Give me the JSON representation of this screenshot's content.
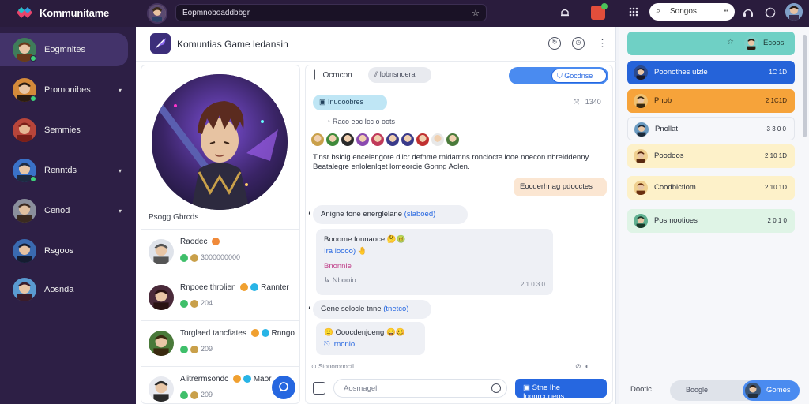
{
  "topbar": {
    "brand": "Kommunitame",
    "search_value": "Eopmnoboaddbbgr",
    "right_search": "Songos"
  },
  "sidebar": {
    "items": [
      {
        "label": "Eogmnites",
        "active": true,
        "chevron": false,
        "online": true
      },
      {
        "label": "Promonibes",
        "chevron": true,
        "online": true
      },
      {
        "label": "Semmies",
        "chevron": false,
        "online": false
      },
      {
        "label": "Renntds",
        "chevron": true,
        "online": true
      },
      {
        "label": "Cenod",
        "chevron": true,
        "online": false
      },
      {
        "label": "Rsgoos",
        "chevron": false,
        "online": false
      },
      {
        "label": "Aosnda",
        "chevron": false,
        "online": false
      }
    ]
  },
  "main": {
    "title": "Komuntias Game ledansin",
    "hero_caption": "Psogg Gbrcds",
    "friends": [
      {
        "name": "Raodec",
        "sub": "3000000000"
      },
      {
        "name": "Rnpoee throlien",
        "extra": "Rannter",
        "sub": "204"
      },
      {
        "name": "Torglaed tancfiates",
        "extra": "Rnngo",
        "sub": "209"
      },
      {
        "name": "Alitrermsondc",
        "extra": "Maor",
        "sub": "209"
      }
    ]
  },
  "chat": {
    "tab1": "Ocmcon",
    "tab2": "Iobnsnoera",
    "btn": "Gocdnse",
    "pill": "Inudoobres",
    "pill_meta": "1340",
    "meta1": "Raco eoc Icc o oots",
    "body": "Tinsr bsicig encelengore diicr defnme rnidamns ronclocte looe noecon nbreiddenny Beatalegre enlolenlget lomeorcie Gonng Aolen.",
    "bubble_right": "Eocderhnag pdocctes",
    "quote1_text": "Anigne tone energlelane",
    "quote1_tag": "(slaboed)",
    "card1": {
      "line1": "Booome fonnaoce",
      "line2": "Ira loooo)",
      "line3": "Bnonnie",
      "meta": "Nbooio",
      "time": "2 1 0 3 0"
    },
    "quote2_text": "Gene selocle tnne",
    "quote2_tag": "(tnetco)",
    "card2": {
      "line1": "Ooocdenjoeng",
      "line2": "Irnonio"
    },
    "foot_left": "Stonoronoctl",
    "composer_placeholder": "Aosmagel.",
    "send_label": "Stne Ihe Ioonrcdneos"
  },
  "right": {
    "rows": [
      {
        "label": "Ecoos",
        "num": "",
        "bg": "#6fd0c5",
        "color": "#1f3a36"
      },
      {
        "label": "Poonothes ulzle",
        "num": "1C 1D",
        "bg": "#2563d9",
        "color": "#ffffff"
      },
      {
        "label": "Pnob",
        "num": "2 1C1D",
        "bg": "#f6a33a",
        "color": "#3a2410"
      },
      {
        "label": "Pnollat",
        "num": "3 3 0 0",
        "bg": "#f6f7fa",
        "color": "#2a2f3a"
      },
      {
        "label": "Poodoos",
        "num": "2 10 1D",
        "bg": "#fdf1c9",
        "color": "#2a2f3a"
      },
      {
        "label": "Coodbictiom",
        "num": "2 10 1D",
        "bg": "#fdf1c9",
        "color": "#2a2f3a"
      },
      {
        "label": "Posmootioes",
        "num": "2 0 1 0",
        "bg": "#dff4e6",
        "color": "#2a2f3a"
      }
    ],
    "foot_label": "Dootic",
    "input": "Boogle",
    "btn": "Gomes"
  }
}
